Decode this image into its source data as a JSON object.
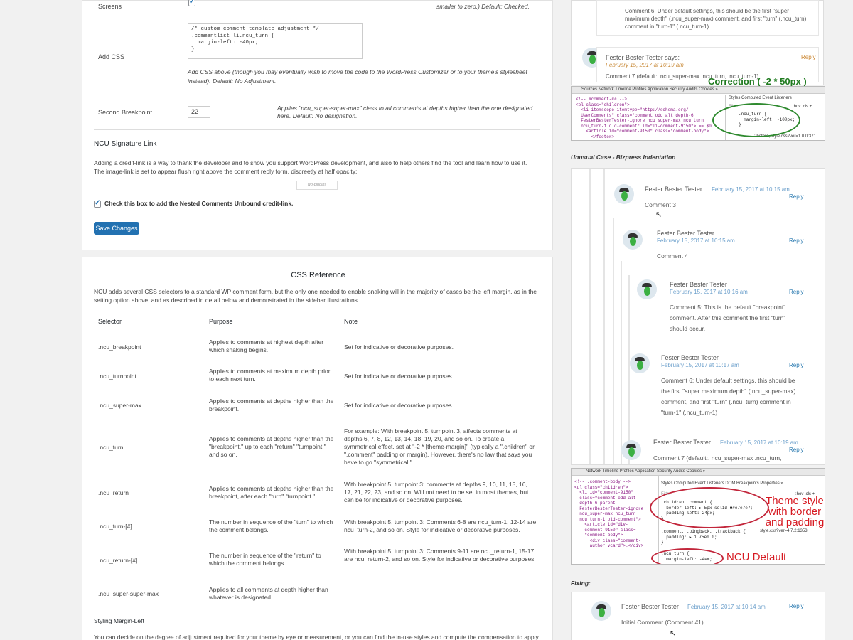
{
  "settings": {
    "screens_label": "Screens",
    "screens_note_tail": "smaller to zero.) Default: Checked.",
    "add_css_label": "Add CSS",
    "css_value": "/* custom comment template adjustment */\n.commentlist li.ncu_turn {\n  margin-left: -40px;\n}",
    "add_css_note": "Add CSS above (though you may eventually wish to move the code to the WordPress Customizer or to your theme's stylesheet instead). Default: No Adjustment.",
    "second_breakpoint_label": "Second Breakpoint",
    "second_breakpoint_value": "22",
    "second_breakpoint_note": "Applies \"ncu_super-super-max\" class to all comments at depths higher than the one designated here. Default: No designation.",
    "signature_heading": "NCU Signature Link",
    "signature_desc": "Adding a credit-link is a way to thank the developer and to show you support WordPress development, and also to help others find the tool and learn how to use it. The image-link is set to appear flush right above the comment reply form, discreetly at half opacity:",
    "credit_image_text": "wp-plugins",
    "credit_checkbox_label": "Check this box to add the Nested Comments Unbound credit-link.",
    "save_button": "Save Changes"
  },
  "reference": {
    "title": "CSS Reference",
    "intro": "NCU adds several CSS selectors to a standard WP comment form, but the only one needed to enable snaking will in the majority of cases be the left margin, as in the setting option above, and as described in detail below and demonstrated in the sidebar illustrations.",
    "headers": {
      "selector": "Selector",
      "purpose": "Purpose",
      "note": "Note"
    },
    "rows": [
      {
        "selector": ".ncu_breakpoint",
        "purpose": "Applies to comments at highest depth after which snaking begins.",
        "note": "Set for indicative or decorative purposes."
      },
      {
        "selector": ".ncu_turnpoint",
        "purpose": "Applies to comments at maximum depth prior to each next turn.",
        "note": "Set for indicative or decorative purposes."
      },
      {
        "selector": ".ncu_super-max",
        "purpose": "Applies to comments at depths higher than the breakpoint.",
        "note": "Set for indicative or decorative purposes."
      },
      {
        "selector": ".ncu_turn",
        "purpose": "Applies to comments at depths higher than the \"breakpoint,\" up to each \"return\" \"turnpoint,\" and so on.",
        "note": "For example: With breakpoint 5, turnpoint 3, affects comments at depths 6, 7, 8, 12, 13, 14, 18, 19, 20, and so on. To create a symmetrical effect, set at \"-2 * [theme-margin]\" (typically a \".children\" or \".comment\" padding or margin). However, there's no law that says you have to go \"symmetrical.\""
      },
      {
        "selector": ".ncu_return",
        "purpose": "Applies to comments at depths higher than the breakpoint, after each \"turn\" \"turnpoint.\"",
        "note": "With breakpoint 5, turnpoint 3: comments at depths 9, 10, 11, 15, 16, 17, 21, 22, 23, and so on. Will not need to be set in most themes, but can be for indicative or decorative purposes."
      },
      {
        "selector": ".ncu_turn-[#]",
        "purpose": "The number in sequence of the \"turn\" to which the comment belongs.",
        "note": "With breakpoint 5, turnpoint 3: Comments 6-8 are ncu_turn-1, 12-14 are ncu_turn-2, and so on. Style for indicative or decorative purposes."
      },
      {
        "selector": ".ncu_return-[#]",
        "purpose": "The number in sequence of the \"return\" to which the comment belongs.",
        "note": "With breakpoint 5, turnpoint 3: Comments 9-11 are ncu_return-1, 15-17 are ncu_return-2, and so on. Style for indicative or decorative purposes."
      },
      {
        "selector": ".ncu_super-super-max",
        "purpose": "Applies to all comments at depth higher than whatever is designated.",
        "note": ""
      }
    ],
    "styling_heading": "Styling Margin-Left",
    "styling_text": "You can decide on the degree of adjustment required for your theme by eye or measurement, or you can find the in-use styles and compute the compensation to apply. In"
  },
  "sidebar": {
    "top_comment_text": "Comment 6: Under default settings, this should be the first \"super maximum depth\" (.ncu_super-max) comment, and first \"turn\" (.ncu_turn) comment in \"turn-1\" (.ncu_turn-1)",
    "top_author": "Fester Bester Tester",
    "top_says": "says:",
    "top_reply": "Reply",
    "top_date": "February 15, 2017 at 10:19 am",
    "top_comment7": "Comment 7 (default:. ncu_super-max .ncu_turn, .ncu_turn-1)",
    "correction_label": "Correction ( -2 * 50px )",
    "devtools1_tabs": "Sources   Network   Timeline   Profiles   Application   Security   Audits   Cookies   »",
    "devtools1_code": "<!-- #comment-## -->\n<ol class=\"children\">\n  <li itemscope itemtype=\"http://schema.org/\n  UserComments\" class=\"comment odd alt depth-6\n  FesterBesterTester-ignore ncu_super-max ncu_turn\n  ncu_turn-1 old-comment\" id=\"li-comment-9150\"> == $0\n    <article id=\"comment-9150\" class=\"comment-body\">\n      </footer>",
    "devtools1_styles_tabs": "Styles  Computed  Event Listeners",
    "devtools1_filter": "Filter",
    "devtools1_hov": ":hov  .cls  +",
    "devtools1_rule": ".ncu_turn {\n  margin-left: -100px;\n}",
    "devtools1_source": "::before, style.css?ver=1.0.0:371",
    "unusual_caption": "Unusual Case - Bizpress Indentation",
    "comments": [
      {
        "author": "Fester Bester Tester",
        "date": "February 15, 2017 at 10:15 am",
        "reply": "Reply",
        "text": "Comment 3"
      },
      {
        "author": "Fester Bester Tester",
        "date": "February 15, 2017 at 10:15 am",
        "reply": "Reply",
        "text": "Comment 4"
      },
      {
        "author": "Fester Bester Tester",
        "date": "February 15, 2017 at 10:16 am",
        "reply": "Reply",
        "text": "Comment 5: This is the default \"breakpoint\" comment. After this comment the first \"turn\" should occur."
      },
      {
        "author": "Fester Bester Tester",
        "date": "February 15, 2017 at 10:17 am",
        "reply": "Reply",
        "text": "Comment 6: Under default settings, this should be the first \"super maximum depth\" (.ncu_super-max) comment, and first \"turn\" (.ncu_turn) comment in \"turn-1\" (.ncu_turn-1)"
      },
      {
        "author": "Fester Bester Tester",
        "date": "February 15, 2017 at 10:19 am",
        "reply": "Reply",
        "text": "Comment 7 (default:. ncu_super-max .ncu_turn,"
      }
    ],
    "devtools2_tabs": "Network   Timeline   Profiles   Application   Security   Audits   Cookies   »",
    "devtools2_code": "<!-- .comment-body -->\n<ul class=\"children\">\n  <li id=\"comment-9150\"\n  class=\"comment odd alt\n  depth-6 parent\n  FesterBesterTester-ignore\n  ncu_super-max ncu_turn\n  ncu_turn-1 old-comment\">\n    <article id=\"div-\n    comment-9150\" class=\n    \"comment-body\">\n      <div class=\"comment-\n      author vcard\">…</div>",
    "devtools2_styles_tabs": "Styles  Computed  Event Listeners  DOM Breakpoints  Properties  »",
    "devtools2_filter": "Filter",
    "devtools2_hov": ":hov  .cls  +",
    "devtools2_rule1": ".children .comment {\n  border-left: ▸ 5px solid ■#e7e7e7;\n  padding-left: 24px;\n}",
    "devtools2_rule2": ".comment, .pingback, .trackback {\n  padding: ▸ 1.75em 0;\n}",
    "devtools2_source": "style.css?ver=4.7.2:1353",
    "devtools2_rule3": ".ncu_turn {\n  margin-left: -4em;",
    "theme_style_label": "Theme style with border and padding",
    "ncu_default_label": "NCU Default",
    "fixing_caption": "Fixing:",
    "fixing_author": "Fester Bester Tester",
    "fixing_date": "February 15, 2017 at 10:14 am",
    "fixing_reply": "Reply",
    "fixing_text": "Initial Comment (Comment #1)"
  },
  "colors": {
    "primary_button": "#2271b1",
    "annotation_red": "#d71921",
    "annotation_green": "#1e7a1e",
    "avatar_green": "#3cb043",
    "date_blue": "#6b9fcb"
  }
}
